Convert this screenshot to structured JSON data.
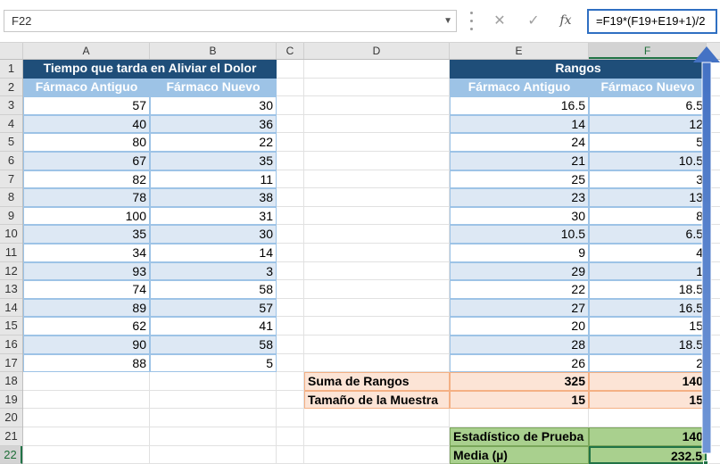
{
  "formula_bar": {
    "name_box": "F22",
    "cancel_icon": "✕",
    "enter_icon": "✓",
    "fx_label": "fx",
    "formula": "=F19*(F19+E19+1)/2"
  },
  "columns": [
    "A",
    "B",
    "C",
    "D",
    "E",
    "F"
  ],
  "rows": [
    "1",
    "2",
    "3",
    "4",
    "5",
    "6",
    "7",
    "8",
    "9",
    "10",
    "11",
    "12",
    "13",
    "14",
    "15",
    "16",
    "17",
    "18",
    "19",
    "20",
    "21",
    "22"
  ],
  "left_table": {
    "title": "Tiempo que tarda en Aliviar el Dolor",
    "headers": [
      "Fármaco Antiguo",
      "Fármaco Nuevo"
    ],
    "values": [
      [
        "57",
        "30"
      ],
      [
        "40",
        "36"
      ],
      [
        "80",
        "22"
      ],
      [
        "67",
        "35"
      ],
      [
        "82",
        "11"
      ],
      [
        "78",
        "38"
      ],
      [
        "100",
        "31"
      ],
      [
        "35",
        "30"
      ],
      [
        "34",
        "14"
      ],
      [
        "93",
        "3"
      ],
      [
        "74",
        "58"
      ],
      [
        "89",
        "57"
      ],
      [
        "62",
        "41"
      ],
      [
        "90",
        "58"
      ],
      [
        "88",
        "5"
      ]
    ]
  },
  "right_table": {
    "title": "Rangos",
    "headers": [
      "Fármaco Antiguo",
      "Fármaco Nuevo"
    ],
    "values": [
      [
        "16.5",
        "6.5"
      ],
      [
        "14",
        "12"
      ],
      [
        "24",
        "5"
      ],
      [
        "21",
        "10.5"
      ],
      [
        "25",
        "3"
      ],
      [
        "23",
        "13"
      ],
      [
        "30",
        "8"
      ],
      [
        "10.5",
        "6.5"
      ],
      [
        "9",
        "4"
      ],
      [
        "29",
        "1"
      ],
      [
        "22",
        "18.5"
      ],
      [
        "27",
        "16.5"
      ],
      [
        "20",
        "15"
      ],
      [
        "28",
        "18.5"
      ],
      [
        "26",
        "2"
      ]
    ]
  },
  "summary": {
    "sum_label": "Suma de Rangos",
    "sum_e": "325",
    "sum_f": "140",
    "size_label": "Tamaño de la Muestra",
    "size_e": "15",
    "size_f": "15"
  },
  "stats": {
    "test_label": "Estadístico de Prueba",
    "test_value": "140",
    "mean_label": "Media (µ)",
    "mean_value": "232.5"
  },
  "selected_cell": "F22",
  "colors": {
    "title_bg": "#1f4e79",
    "header_bg": "#9dc3e6",
    "band_bg": "#dde8f4",
    "summary_bg": "#fce4d6",
    "stats_bg": "#a9d08e",
    "selection": "#217346",
    "arrow": "#4472c4"
  }
}
